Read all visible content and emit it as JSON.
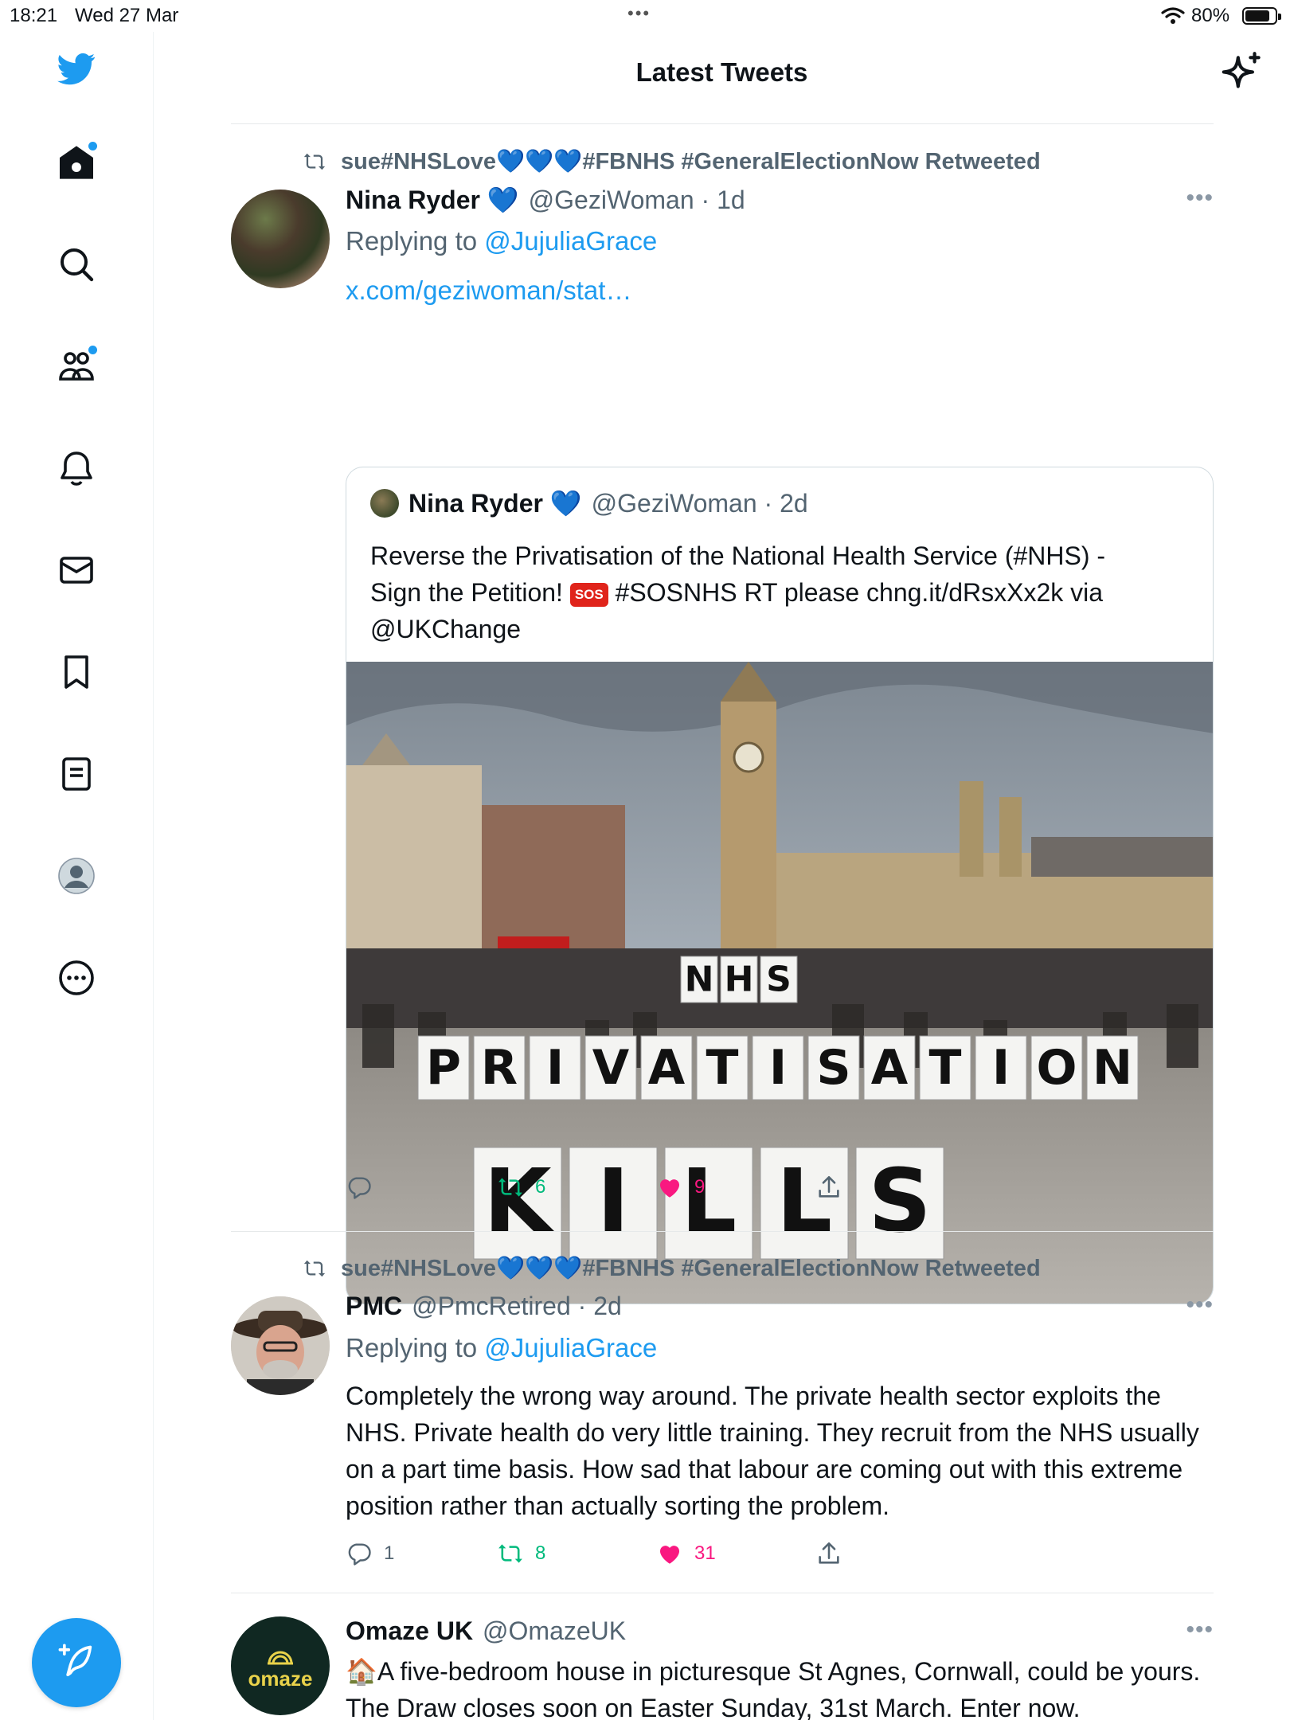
{
  "status_bar": {
    "time": "18:21",
    "date": "Wed 27 Mar",
    "battery": "80%"
  },
  "header": {
    "title": "Latest Tweets"
  },
  "tweets": [
    {
      "retweeted_by": "sue#NHSLove💙💙💙#FBNHS #GeneralElectionNow Retweeted",
      "name": "Nina Ryder 💙",
      "handle": "@GeziWoman · 1d",
      "replying_prefix": "Replying to ",
      "replying_to": "@JujuliaGrace",
      "link": "x.com/geziwoman/stat…",
      "quote": {
        "name": "Nina Ryder 💙",
        "handle": "@GeziWoman · 2d",
        "text_line1": "Reverse the Privatisation of the National Health Service (#NHS) -",
        "text_line2a": "Sign the Petition!",
        "sos": "SOS",
        "text_line2b": "#SOSNHS RT please chng.it/dRsxXx2k via",
        "text_line3": "@UKChange",
        "image_letters": {
          "row1": [
            "N",
            "H",
            "S"
          ],
          "row2": [
            "P",
            "R",
            "I",
            "V",
            "A",
            "T",
            "I",
            "S",
            "A",
            "T",
            "I",
            "O",
            "N"
          ],
          "row3": [
            "K",
            "I",
            "L",
            "L",
            "S"
          ]
        }
      },
      "retweets": "6",
      "likes": "9"
    },
    {
      "retweeted_by": "sue#NHSLove💙💙💙#FBNHS #GeneralElectionNow Retweeted",
      "name": "PMC",
      "handle": "@PmcRetired · 2d",
      "replying_prefix": "Replying to ",
      "replying_to": "@JujuliaGrace",
      "text": "Completely the wrong way around. The private health sector exploits the NHS. Private health do very little training. They recruit from the NHS usually on a part time basis. How sad that labour are coming out with this extreme position rather than actually sorting the problem.",
      "replies": "1",
      "retweets": "8",
      "likes": "31"
    },
    {
      "name": "Omaze UK",
      "handle": "@OmazeUK",
      "avatar_text": "omaze",
      "text": "🏠A five-bedroom house in picturesque St Agnes, Cornwall, could be yours. The Draw closes soon on Easter Sunday, 31st March. Enter now."
    }
  ],
  "colors": {
    "accent": "#1d9bf0",
    "retweet_green": "#00ba7c",
    "like_pink": "#f91880",
    "secondary_text": "#536471"
  }
}
